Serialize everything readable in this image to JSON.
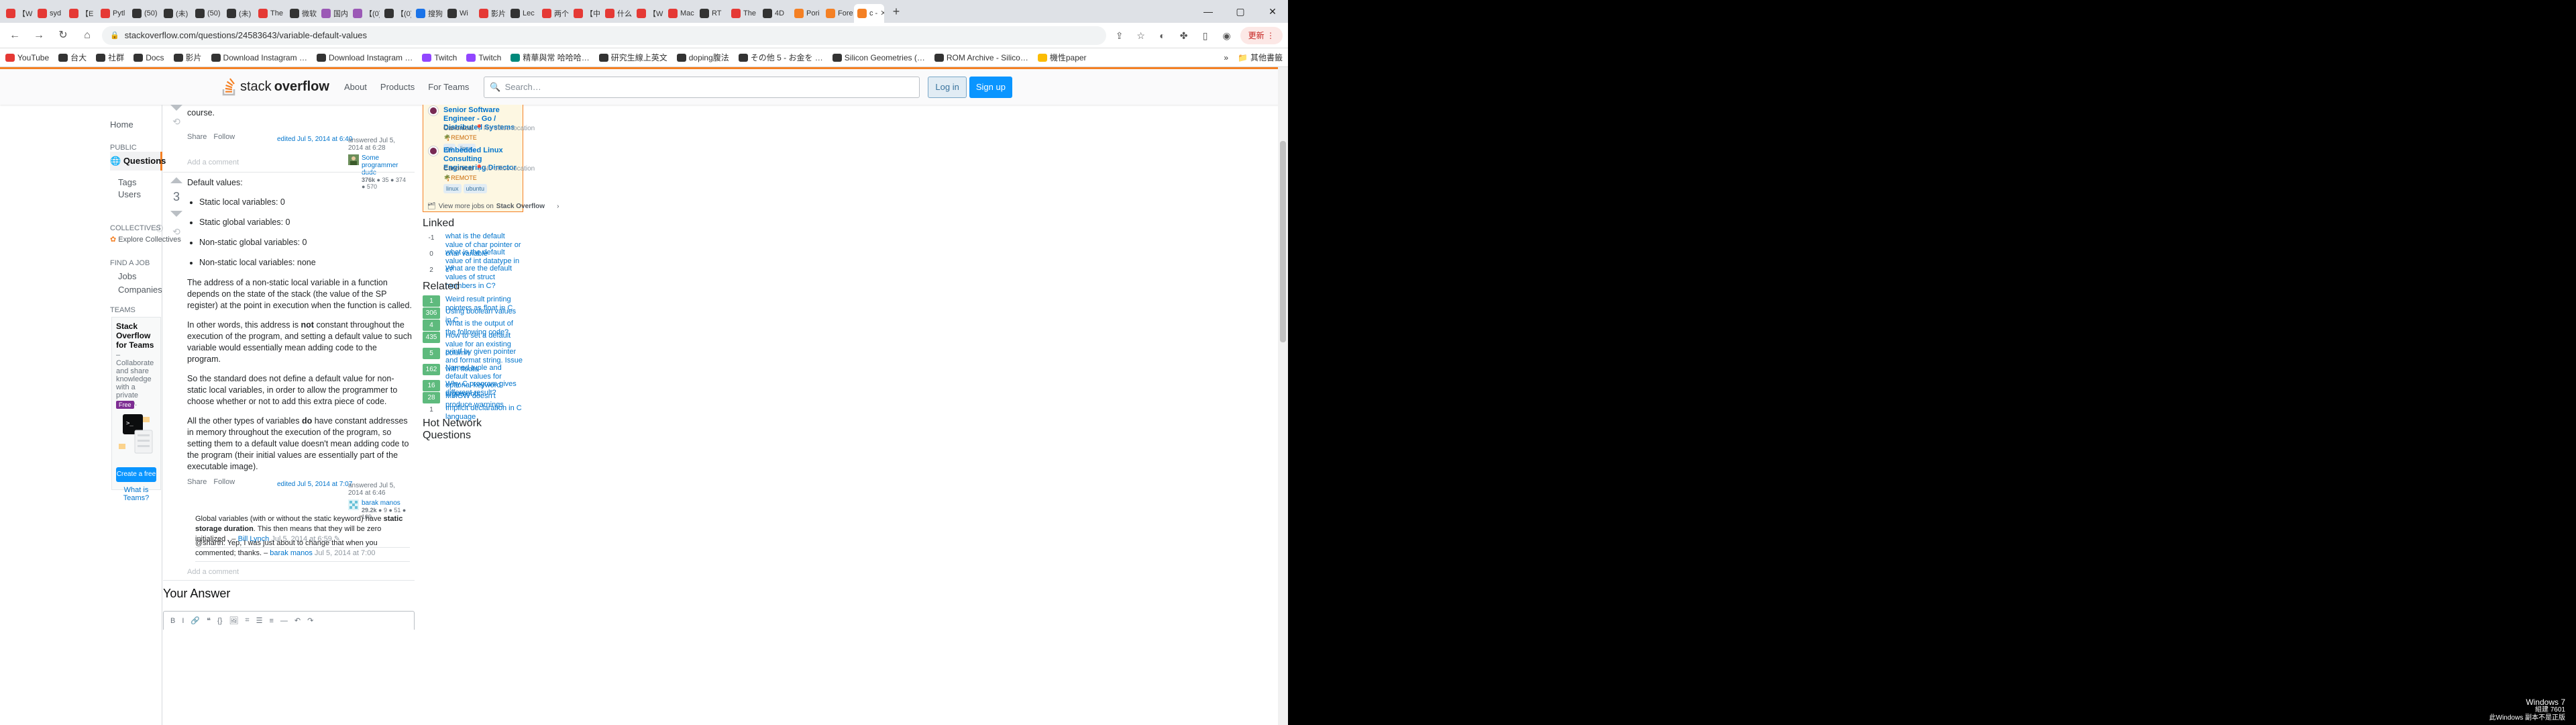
{
  "browser": {
    "tabs": [
      {
        "label": "【Wi",
        "color": "#e53935"
      },
      {
        "label": "syd",
        "color": "#e53935"
      },
      {
        "label": "【E",
        "color": "#e53935"
      },
      {
        "label": "Pytl",
        "color": "#e53935"
      },
      {
        "label": "(50)",
        "color": "#333"
      },
      {
        "label": "(未)",
        "color": "#333"
      },
      {
        "label": "(50)",
        "color": "#333"
      },
      {
        "label": "(未)",
        "color": "#333"
      },
      {
        "label": "The",
        "color": "#e53935"
      },
      {
        "label": "微软",
        "color": "#333"
      },
      {
        "label": "国内",
        "color": "#9b59b6"
      },
      {
        "label": "【(0)",
        "color": "#9b59b6"
      },
      {
        "label": "【(0)",
        "color": "#333"
      },
      {
        "label": "搜狗",
        "color": "#1a73e8"
      },
      {
        "label": "Wi",
        "color": "#333"
      },
      {
        "label": "影片",
        "color": "#e53935"
      },
      {
        "label": "Lec",
        "color": "#333"
      },
      {
        "label": "两个",
        "color": "#e53935"
      },
      {
        "label": "【中",
        "color": "#e53935"
      },
      {
        "label": "什么",
        "color": "#e53935"
      },
      {
        "label": "【W",
        "color": "#e53935"
      },
      {
        "label": "Mac",
        "color": "#e53935"
      },
      {
        "label": "RT",
        "color": "#333"
      },
      {
        "label": "The",
        "color": "#e53935"
      },
      {
        "label": "4D",
        "color": "#333"
      },
      {
        "label": "Pori",
        "color": "#f48024"
      },
      {
        "label": "Fore",
        "color": "#f48024"
      },
      {
        "label": "c -",
        "color": "#f48024"
      }
    ],
    "active_tab_index": 27,
    "new_tab": "+",
    "window_buttons": [
      "—",
      "▢",
      "✕"
    ],
    "url": "stackoverflow.com/questions/24583643/variable-default-values",
    "update_label": "更新 ⋮",
    "bookmarks": [
      {
        "label": "YouTube",
        "color": "#e53935"
      },
      {
        "label": "台大",
        "color": "#333"
      },
      {
        "label": "社群",
        "color": "#333"
      },
      {
        "label": "Docs",
        "color": "#333"
      },
      {
        "label": "影片",
        "color": "#333"
      },
      {
        "label": "Download Instagram …",
        "color": "#333"
      },
      {
        "label": "Download Instagram …",
        "color": "#333"
      },
      {
        "label": "Twitch",
        "color": "#9146ff"
      },
      {
        "label": "Twitch",
        "color": "#9146ff"
      },
      {
        "label": "精華與常 哈哈哈…",
        "color": "#00897b"
      },
      {
        "label": "研究生線上英文",
        "color": "#333"
      },
      {
        "label": "doping腹法",
        "color": "#333"
      },
      {
        "label": "その他 5 - お金を …",
        "color": "#333"
      },
      {
        "label": "Silicon Geometries (…",
        "color": "#333"
      },
      {
        "label": "ROM Archive - Silico…",
        "color": "#333"
      },
      {
        "label": "機性paper",
        "color": "#fbbc04"
      }
    ],
    "bookmarks_more": "»",
    "other_bookmarks": "其他書籤"
  },
  "so": {
    "brand": {
      "stack": "stack",
      "overflow": "overflow"
    },
    "nav": [
      "About",
      "Products",
      "For Teams"
    ],
    "search_placeholder": "Search…",
    "login": "Log in",
    "signup": "Sign up",
    "left": {
      "home": "Home",
      "public": "PUBLIC",
      "questions": "Questions",
      "tags": "Tags",
      "users": "Users",
      "collectives": "COLLECTIVES",
      "explore": "Explore Collectives",
      "findjob": "FIND A JOB",
      "jobs": "Jobs",
      "companies": "Companies",
      "teams": "TEAMS",
      "teams_title": "Stack Overflow for Teams",
      "teams_desc": "– Collaborate and share knowledge with a private group.",
      "free_badge": "Free",
      "create_team": "Create a free Team",
      "why_teams": "What is Teams?"
    },
    "answer1": {
      "tail": "course.",
      "share": "Share",
      "follow": "Follow",
      "edited": "edited Jul 5, 2014 at 6:40",
      "answered": "answered Jul 5, 2014 at 6:28",
      "user": "Some programmer dude",
      "rep": "376k",
      "badges": "● 35  ● 374  ● 570",
      "add_comment": "Add a comment"
    },
    "answer2": {
      "score": "3",
      "intro": "Default values:",
      "list": [
        "Static local variables: 0",
        "Static global variables: 0",
        "Non-static global variables: 0",
        "Non-static local variables: none"
      ],
      "p1": "The address of a non-static local variable in a function depends on the state of the stack (the value of the SP register) at the point in execution when the function is called.",
      "p2a": "In other words, this address is ",
      "p2b": "not",
      "p2c": " constant throughout the execution of the program, and setting a default value to such variable would essentially mean adding code to the program.",
      "p3": "So the standard does not define a default value for non-static local variables, in order to allow the programmer to choose whether or not to add this extra piece of code.",
      "p4a": "All the other types of variables ",
      "p4b": "do",
      "p4c": " have constant addresses in memory throughout the execution of the program, so setting them to a default value doesn't mean adding code to the program (their initial values are essentially part of the executable image).",
      "share": "Share",
      "follow": "Follow",
      "edited": "edited Jul 5, 2014 at 7:07",
      "answered": "answered Jul 5, 2014 at 6:46",
      "user": "barak manos",
      "rep": "29.2k",
      "badges": "● 9  ● 51  ● 109",
      "comments": [
        {
          "a": "Global variables (with or without the static keyword) have ",
          "b": "static storage duration",
          "c": ". This then means that they will be zero initialized . – ",
          "u": "Bill Lynch",
          "d": " Jul 5, 2014 at 6:59 ✎"
        },
        {
          "a": "@sharth: Yep, I was just about to change that when you commented; thanks. – ",
          "u": "barak manos",
          "d": " Jul 5, 2014 at 7:00"
        }
      ],
      "add_comment": "Add a comment"
    },
    "your_answer": "Your Answer",
    "editor_tools": [
      "B",
      "I",
      "🔗",
      "❝",
      "{}",
      "🖼",
      "⌗",
      "☰",
      "≡",
      "—",
      "↶",
      "↷"
    ],
    "jobs": [
      {
        "title": "Senior Software Engineer - Go / Distributed Systems",
        "company": "Canonical",
        "location": "No office location",
        "remote": "REMOTE",
        "tags": [
          "go",
          "linux"
        ]
      },
      {
        "title": "Embedded Linux Consulting Engineering Director",
        "company": "Canonical",
        "location": "No office location",
        "remote": "REMOTE",
        "tags": [
          "linux",
          "ubuntu"
        ]
      }
    ],
    "more_jobs": "View more jobs on",
    "more_jobs_brand": "Stack Overflow",
    "linked_title": "Linked",
    "linked": [
      {
        "count": "-1",
        "text": "what is the default value of char pointer or char variable",
        "accepted": false
      },
      {
        "count": "0",
        "text": "what is the default value of int datatype in c?",
        "accepted": false
      },
      {
        "count": "2",
        "text": "What are the default values of struct members in C?",
        "accepted": false
      }
    ],
    "related_title": "Related",
    "related": [
      {
        "count": "1",
        "text": "Weird result printing pointers as float in C",
        "accepted": true
      },
      {
        "count": "306",
        "text": "Using boolean values in C",
        "accepted": true
      },
      {
        "count": "4",
        "text": "What is the output of the following code?",
        "accepted": true
      },
      {
        "count": "435",
        "text": "How to set a default value for an existing column",
        "accepted": true
      },
      {
        "count": "5",
        "text": "printf by given pointer and format string. Issue with floats",
        "accepted": true
      },
      {
        "count": "162",
        "text": "Named tuple and default values for optional keyword arguments",
        "accepted": true
      },
      {
        "count": "16",
        "text": "Why C program gives different result?",
        "accepted": true
      },
      {
        "count": "28",
        "text": "MinGW doesn't produce warnings",
        "accepted": true
      },
      {
        "count": "1",
        "text": "Implicit declaration in C language",
        "accepted": false
      }
    ],
    "hot_title": "Hot Network Questions"
  },
  "desktop": {
    "wm1": "Windows 7",
    "wm2": "組建 7601",
    "wm3": "此Windows 副本不是正版"
  }
}
